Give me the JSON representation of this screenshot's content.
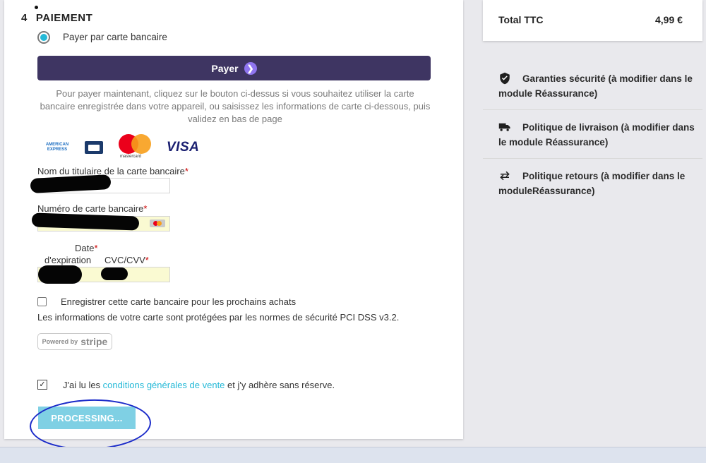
{
  "step": {
    "number": "4",
    "title": "PAIEMENT"
  },
  "payment_option": {
    "label": "Payer par carte bancaire"
  },
  "pay_button": {
    "label": "Payer"
  },
  "help_text": "Pour payer maintenant, cliquez sur le bouton ci-dessus si vous souhaitez utiliser la carte bancaire enregistrée dans votre appareil, ou saisissez les informations de carte ci-dessous, puis validez en bas de page",
  "card_logos": {
    "amex_line1": "AMERICAN",
    "amex_line2": "EXPRESS",
    "mastercard": "mastercard",
    "visa": "VISA"
  },
  "form": {
    "holder_label": "Nom du titulaire de la carte bancaire",
    "number_label": "Numéro de carte bancaire",
    "date_label_1": "Date",
    "date_label_2": "d'expiration",
    "cvc_label": "CVC/CVV",
    "required_mark": "*"
  },
  "save_card_label": "Enregistrer cette carte bancaire pour les prochains achats",
  "pci_text": "Les informations de votre carte sont protégées par les normes de sécurité PCI DSS v3.2.",
  "stripe_badge": {
    "powered": "Powered by",
    "brand": "stripe"
  },
  "terms": {
    "prefix": "J'ai lu les ",
    "link": "conditions générales de vente",
    "suffix": " et j'y adhère sans réserve."
  },
  "submit_button": {
    "label": "PROCESSING..."
  },
  "summary": {
    "total_label": "Total TTC",
    "total_value": "4,99 €"
  },
  "reassurance": [
    {
      "icon": "shield-icon",
      "text": "Garanties sécurité (à modifier dans le module Réassurance)"
    },
    {
      "icon": "truck-icon",
      "text": "Politique de livraison (à modifier dans le module Réassurance)"
    },
    {
      "icon": "swap-arrows-icon",
      "text": "Politique retours (à modifier dans le moduleRéassurance)"
    }
  ],
  "colors": {
    "accent": "#25b9d7",
    "pay_button": "#3e3562",
    "annotation": "#1a2ac9"
  }
}
